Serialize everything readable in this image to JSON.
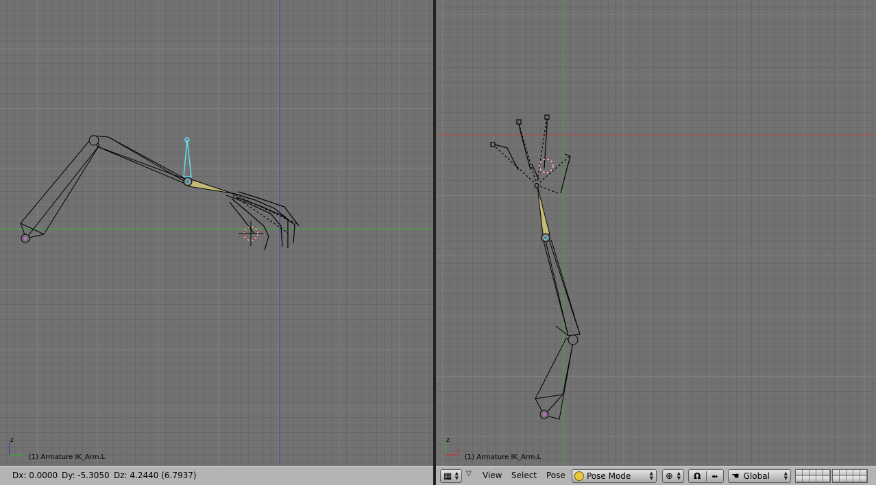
{
  "left_view": {
    "object_label": "(1) Armature IK_Arm.L",
    "axis_labels": {
      "up": "z",
      "side": ""
    }
  },
  "right_view": {
    "object_label": "(1) Armature IK_Arm.L",
    "axis_labels": {
      "up": "z",
      "side": "x"
    }
  },
  "transform_readout": {
    "dx": "Dx: 0.0000",
    "dy": "Dy: -5.3050",
    "dz": "Dz: 4.2440 (6.7937)"
  },
  "header": {
    "menus": [
      "View",
      "Select",
      "Pose"
    ],
    "mode": "Pose Mode",
    "orientation": "Global"
  },
  "colors": {
    "background": "#727272",
    "header": "#b4b4b4",
    "selected_bone": "#c2bb78",
    "ik_bone": "#60e0f0",
    "x_axis": "#b04040",
    "y_axis": "#3ea83e",
    "z_axis": "#4040c0"
  }
}
